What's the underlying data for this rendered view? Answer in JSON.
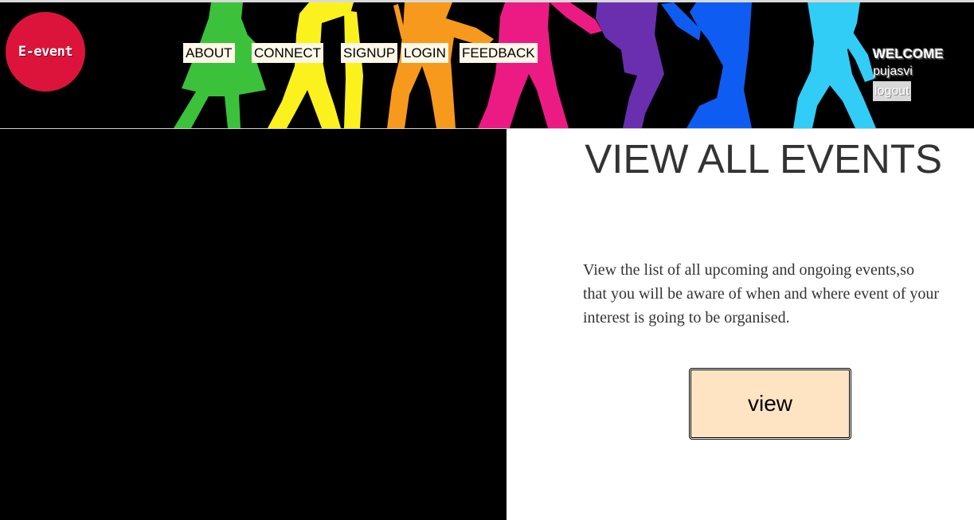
{
  "header": {
    "logo_text": "E-event",
    "nav": {
      "about": "ABOUT",
      "connect": "CONNECT",
      "signup": "SIGNUP",
      "login": "LOGIN",
      "feedback": "FEEDBACK"
    },
    "welcome": {
      "title": "WELCOME",
      "username": "pujasvi",
      "logout_label": "logout"
    }
  },
  "main": {
    "title": "VIEW ALL EVENTS",
    "description": "View the list of all upcoming and ongoing events,so that you will be aware of when and where event of your interest is going to be organised.",
    "view_button_label": "view"
  },
  "colors": {
    "logo_background": "#dc143c",
    "nav_item_background": "#fff8e7",
    "view_button_background": "#ffe4c4",
    "header_background": "#000000",
    "left_panel_background": "#000000",
    "dancer_colors": [
      "#3cc13b",
      "#fbf21d",
      "#f7991c",
      "#ec1b84",
      "#6a2fae",
      "#0f5cf2",
      "#31cdf7"
    ]
  },
  "icons": {
    "banner": "dancers-silhouette-banner"
  }
}
